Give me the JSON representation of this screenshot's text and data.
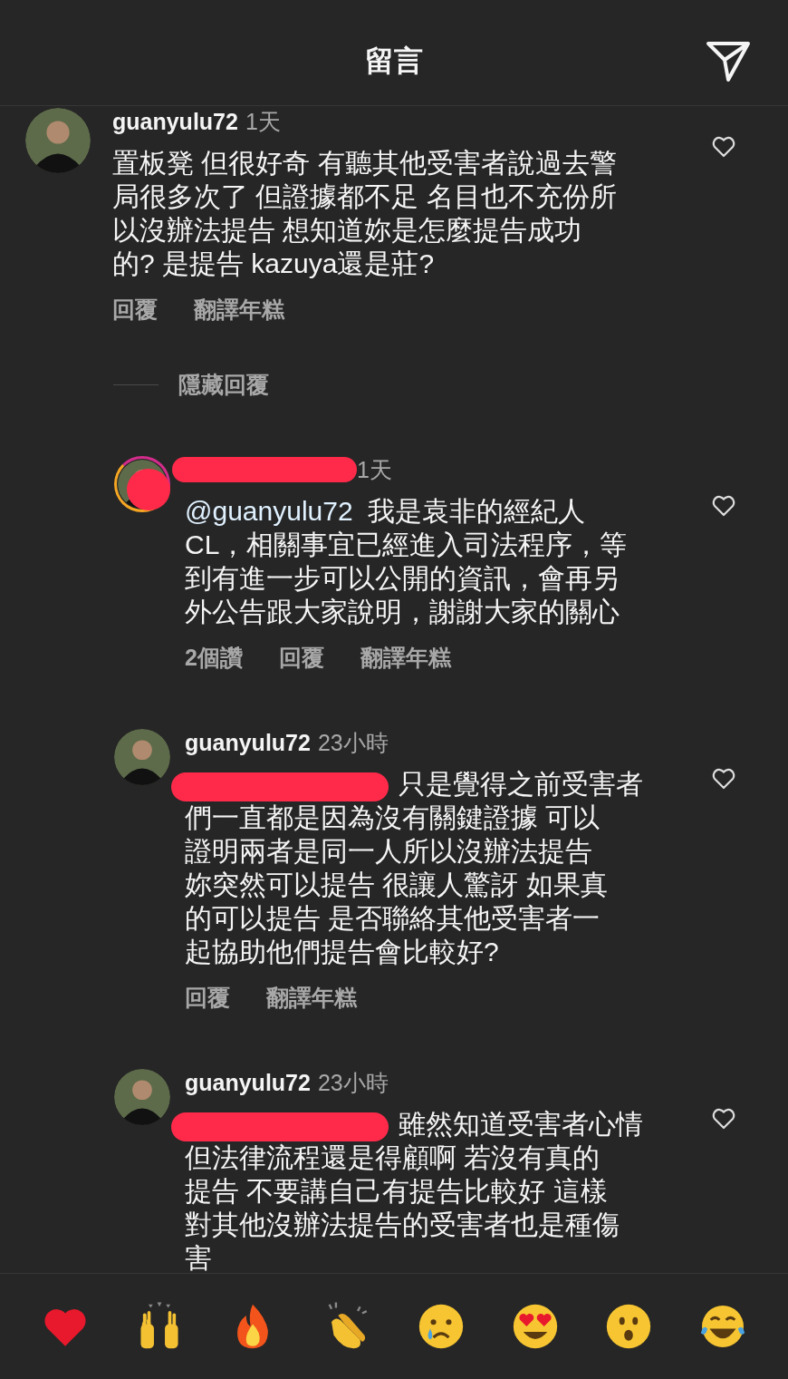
{
  "header": {
    "title": "留言"
  },
  "comments": [
    {
      "username": "guanyulu72",
      "time": "1天",
      "lines": [
        "置板凳 但很好奇 有聽其他受害者說過去警",
        "局很多次了 但證據都不足 名目也不充份所",
        "以沒辦法提告 想知道妳是怎麼提告成功",
        "的? 是提告 kazuya還是莊?"
      ],
      "actions": [
        "回覆",
        "翻譯年糕"
      ],
      "hide_replies": "隱藏回覆",
      "replies": [
        {
          "username_redacted": true,
          "avatar_redacted": true,
          "story_ring": true,
          "mention_redacted": false,
          "time": "1天",
          "mention": "@guanyulu72",
          "lines": [
            "我是袁非的經紀人",
            "CL，相關事宜已經進入司法程序，等",
            "到有進一步可以公開的資訊，會再另",
            "外公告跟大家說明，謝謝大家的關心"
          ],
          "actions": [
            "2個讚",
            "回覆",
            "翻譯年糕"
          ]
        },
        {
          "username": "guanyulu72",
          "username_redacted": false,
          "avatar_redacted": false,
          "story_ring": false,
          "mention_redacted": true,
          "time": "23小時",
          "lines": [
            "只是覺得之前受害者",
            "們一直都是因為沒有關鍵證據 可以",
            "證明兩者是同一人所以沒辦法提告",
            "妳突然可以提告 很讓人驚訝 如果真",
            "的可以提告 是否聯絡其他受害者一",
            "起協助他們提告會比較好?"
          ],
          "actions": [
            "回覆",
            "翻譯年糕"
          ]
        },
        {
          "username": "guanyulu72",
          "username_redacted": false,
          "avatar_redacted": false,
          "story_ring": false,
          "mention_redacted": true,
          "time": "23小時",
          "lines": [
            "雖然知道受害者心情",
            "但法律流程還是得顧啊 若沒有真的",
            "提告 不要講自己有提告比較好 這樣",
            "對其他沒辦法提告的受害者也是種傷",
            "害"
          ]
        }
      ]
    }
  ],
  "reactions": [
    {
      "kind": "heart"
    },
    {
      "kind": "raised-hands"
    },
    {
      "kind": "fire"
    },
    {
      "kind": "clap"
    },
    {
      "kind": "cry"
    },
    {
      "kind": "heart-eyes"
    },
    {
      "kind": "surprised"
    },
    {
      "kind": "laugh"
    }
  ]
}
